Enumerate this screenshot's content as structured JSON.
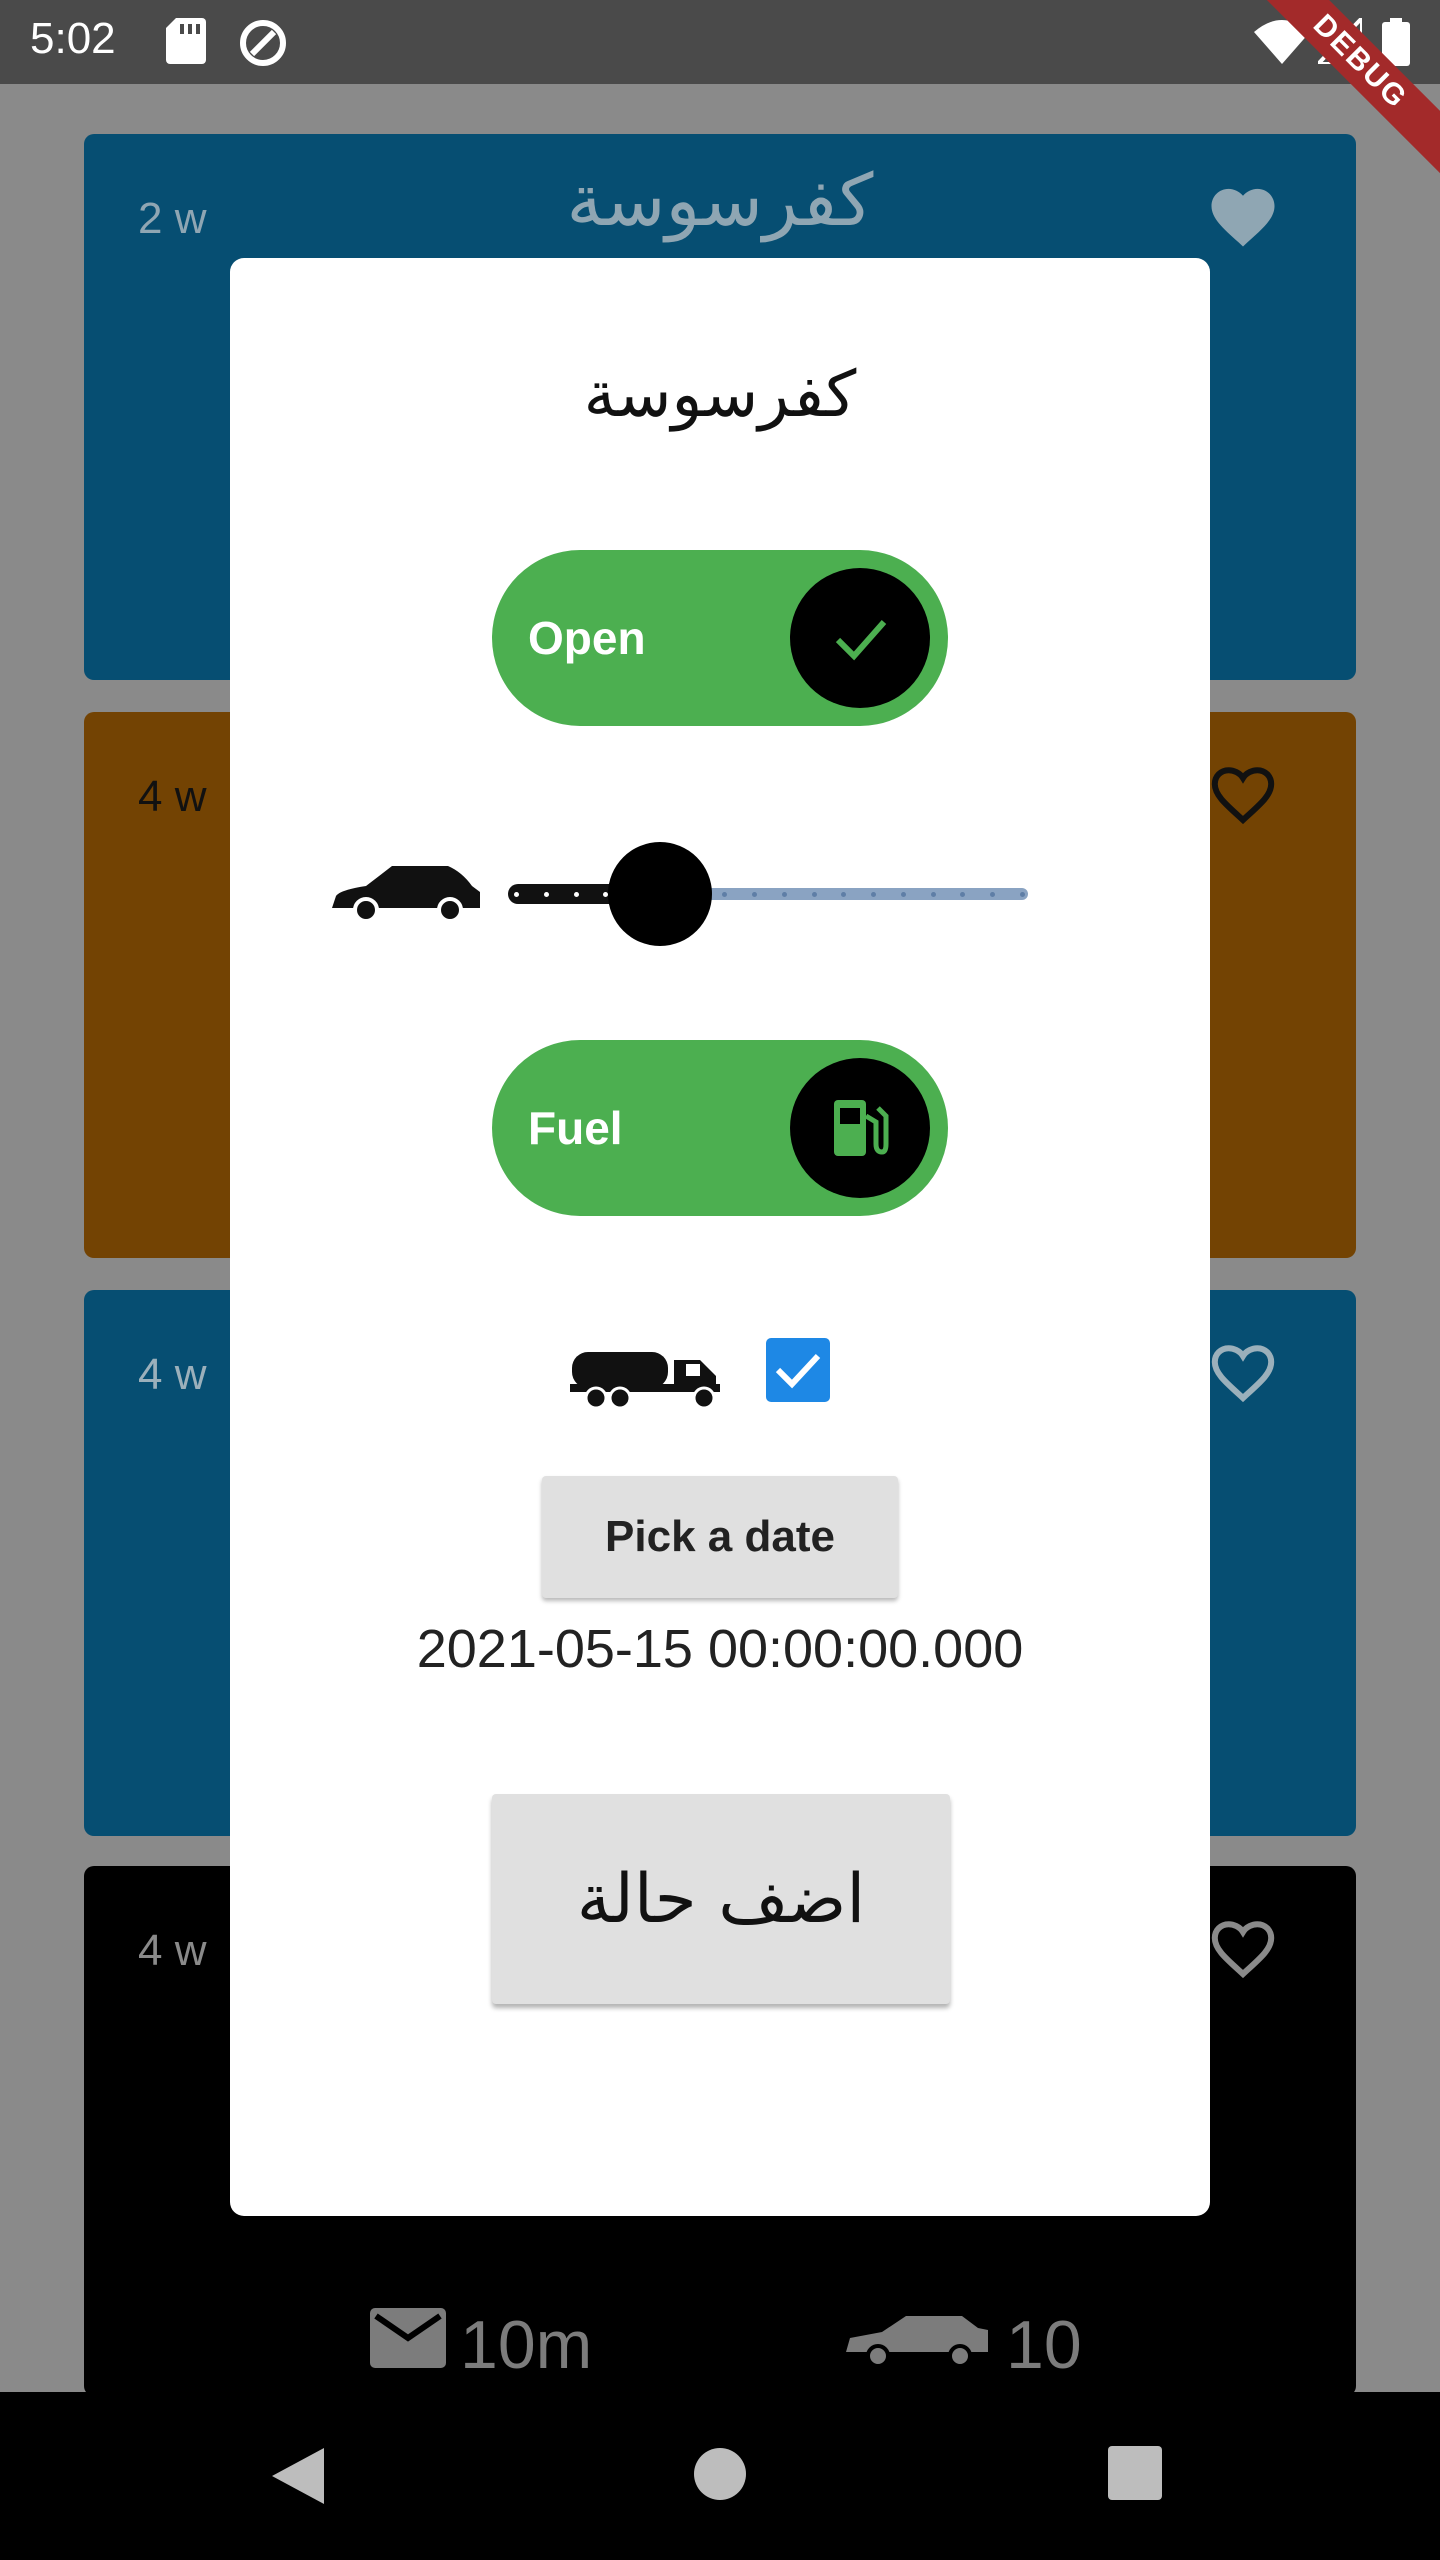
{
  "status_bar": {
    "time": "5:02",
    "icons": [
      "sd-card-icon",
      "sync-icon",
      "wifi-icon",
      "signal-icon",
      "battery-icon"
    ],
    "debug_label": "DEBUG"
  },
  "background_cards": [
    {
      "age": "2 w",
      "title": "كفرسوسة",
      "favorite": true,
      "color": "#064e72"
    },
    {
      "age": "4 w",
      "favorite": false,
      "color": "#734303"
    },
    {
      "age": "4 w",
      "favorite": false,
      "color": "#064e72"
    },
    {
      "age": "4 w",
      "favorite": false,
      "color": "#000000",
      "stats": {
        "message_time": "10m",
        "car_count": "10"
      }
    }
  ],
  "dialog": {
    "title": "كفرسوسة",
    "open_toggle": {
      "label": "Open",
      "checked": true,
      "icon": "check-icon",
      "color": "#4caf50"
    },
    "car_slider": {
      "icon": "car-icon",
      "level": 0.25
    },
    "fuel_toggle": {
      "label": "Fuel",
      "checked": true,
      "icon": "gas-station-icon",
      "color": "#4caf50"
    },
    "tanker": {
      "icon": "tanker-truck-icon",
      "checked": true
    },
    "pick_date_label": "Pick a date",
    "selected_date": "2021-05-15 00:00:00.000",
    "add_status_label": "اضف حالة"
  },
  "nav_bar": {
    "buttons": [
      "back-icon",
      "home-icon",
      "recents-icon"
    ]
  }
}
